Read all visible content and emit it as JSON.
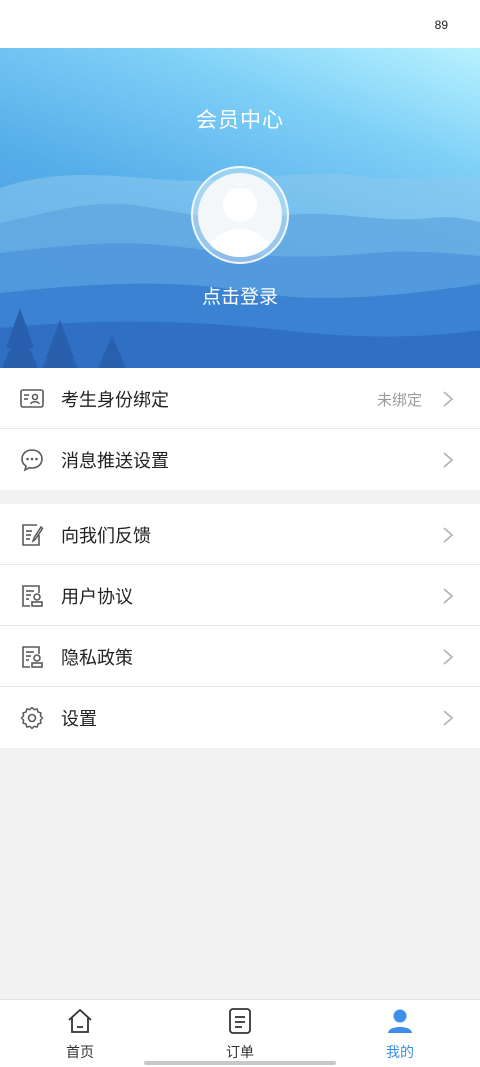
{
  "status_bar": {
    "text": "89"
  },
  "hero": {
    "title": "会员中心",
    "login_label": "点击登录",
    "avatar_icon": "default-user-avatar"
  },
  "menu_group_1": [
    {
      "icon": "id-card-icon",
      "label": "考生身份绑定",
      "value": "未绑定"
    },
    {
      "icon": "message-bubble-icon",
      "label": "消息推送设置",
      "value": ""
    }
  ],
  "menu_group_2": [
    {
      "icon": "feedback-edit-icon",
      "label": "向我们反馈",
      "value": ""
    },
    {
      "icon": "document-stamp-icon",
      "label": "用户协议",
      "value": ""
    },
    {
      "icon": "document-stamp-icon",
      "label": "隐私政策",
      "value": ""
    },
    {
      "icon": "gear-icon",
      "label": "设置",
      "value": ""
    }
  ],
  "tabbar": [
    {
      "icon": "home-icon",
      "label": "首页",
      "active": false
    },
    {
      "icon": "order-list-icon",
      "label": "订单",
      "active": false
    },
    {
      "icon": "user-icon",
      "label": "我的",
      "active": true
    }
  ],
  "colors": {
    "accent": "#3d8ee6",
    "icon_gray": "#5a5a5a",
    "chevron": "#b5b5b5",
    "background": "#f2f2f2"
  }
}
